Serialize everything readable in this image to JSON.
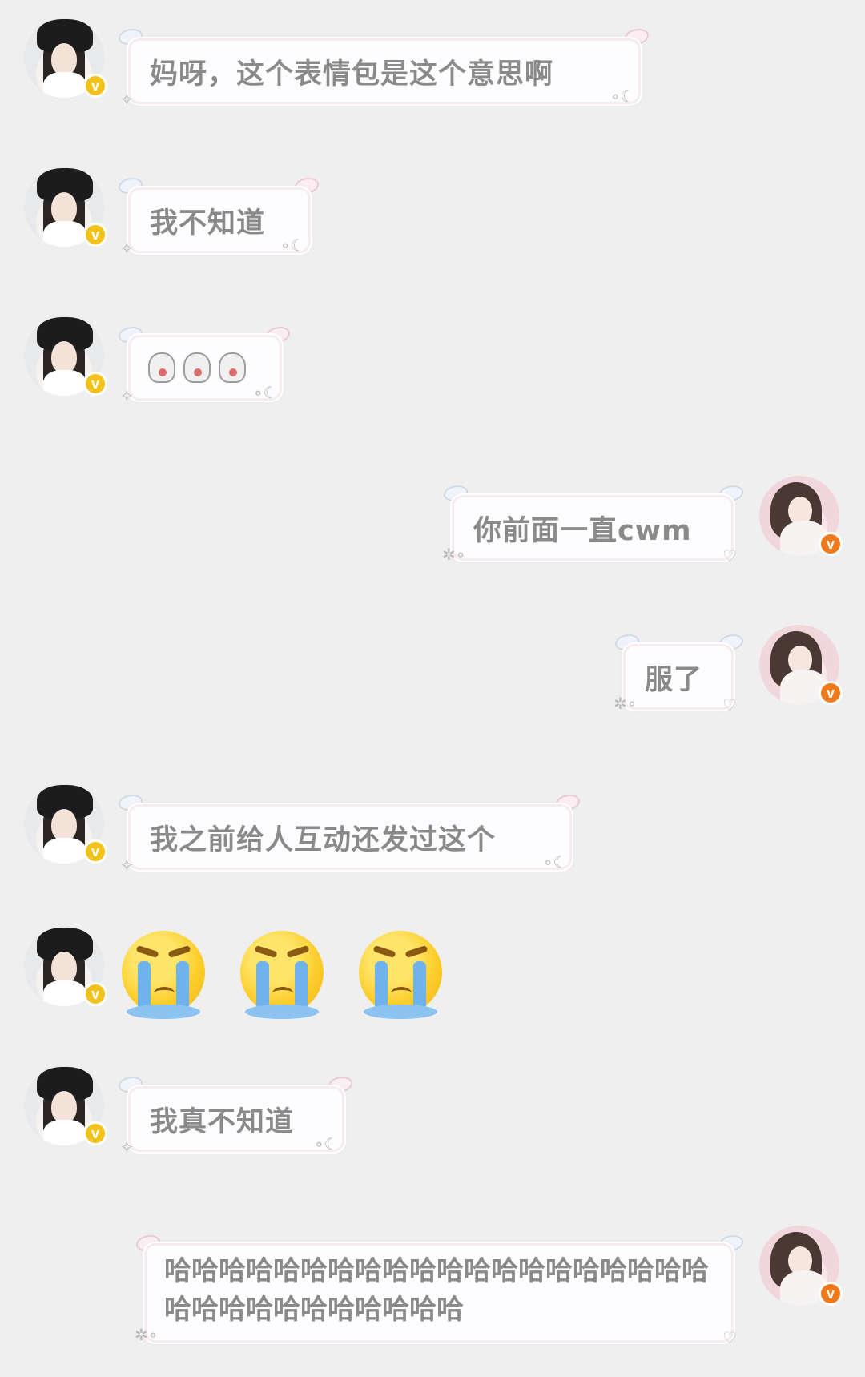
{
  "messages": [
    {
      "side": "left",
      "text": "妈呀，这个表情包是这个意思啊"
    },
    {
      "side": "left",
      "text": "我不知道"
    },
    {
      "side": "left",
      "type": "sticker-row",
      "count": 3
    },
    {
      "side": "right",
      "text": "你前面一直cwm"
    },
    {
      "side": "right",
      "text": "服了"
    },
    {
      "side": "left",
      "text": "我之前给人互动还发过这个"
    },
    {
      "side": "left",
      "type": "emoji-row",
      "emoji": "crying-face",
      "count": 3
    },
    {
      "side": "left",
      "text": "我真不知道"
    },
    {
      "side": "right",
      "text": "哈哈哈哈哈哈哈哈哈哈哈哈哈哈哈哈哈哈哈哈哈哈哈哈哈哈哈哈哈哈哈"
    }
  ],
  "badge_letter": "v",
  "colors": {
    "background": "#efefef",
    "text": "#8a8a8a",
    "left_badge": "#f3c21a",
    "right_badge": "#f07a1b"
  }
}
